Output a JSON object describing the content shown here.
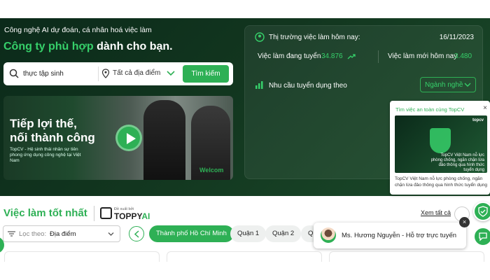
{
  "hero": {
    "subtitle": "Công nghệ AI dự đoán, cá nhân hoá việc làm",
    "title_accent": "Công ty phù hợp",
    "title_rest": " dành cho bạn."
  },
  "search": {
    "keyword_value": "thực tập sinh",
    "location_text": "Tất cả địa điểm",
    "button_label": "Tìm kiếm"
  },
  "banner": {
    "title": "Tiếp lợi thế,\nnối thành công",
    "description": "TopCV - Hệ sinh thái nhân sự tiên phong ứng dụng công nghệ tại Việt Nam",
    "welcome_text": "Welcom"
  },
  "market": {
    "title": "Thị trường việc làm hôm nay:",
    "date": "16/11/2023",
    "active_jobs_label": "Việc làm đang tuyển",
    "active_jobs_value": "34.876",
    "new_jobs_label": "Việc làm mới hôm nay",
    "new_jobs_value": "3.480",
    "demand_title": "Nhu cầu tuyển dụng theo",
    "industry_select": "Ngành nghề"
  },
  "popup": {
    "title": "Tìm việc an toàn cùng TopCV",
    "close": "×",
    "logo_text": "topcv",
    "image_text": "TopCV Việt Nam nỗ lực phòng chống, ngăn chặn lừa đảo thông qua hình thức tuyển dụng",
    "description": "TopCV Việt Nam nỗ lực phòng chống, ngăn chặn lừa đảo thông qua hình thức tuyển dụng"
  },
  "best_jobs": {
    "title": "Việc làm tốt nhất",
    "proposed_by": "Đề xuất bởi",
    "toppy_brand": "TOPPY",
    "toppy_ai": "AI",
    "view_all": "Xem tất cả",
    "filter_label": "Lọc theo:",
    "filter_value": "Địa điểm",
    "chips": [
      "Thành phố Hồ Chí Minh",
      "Quận 1",
      "Quận 2",
      "Q"
    ]
  },
  "chat": {
    "agent": "Ms. Hương Nguyễn - Hỗ trợ trực tuyến",
    "close": "×"
  },
  "colors": {
    "brand_green": "#2eb055",
    "accent_green": "#36d06a",
    "hero_dark": "#0b2a1a"
  }
}
